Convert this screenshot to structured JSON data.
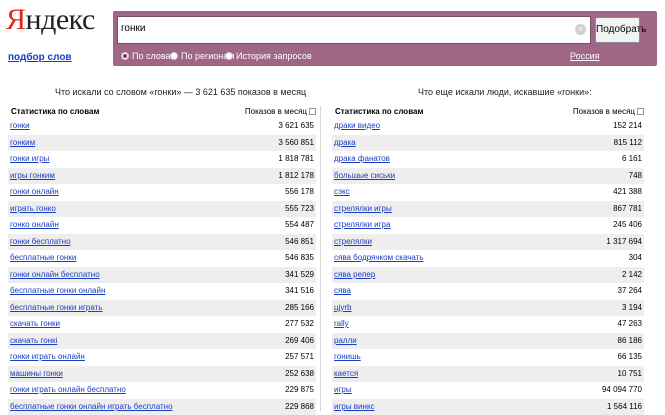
{
  "logo": {
    "first_letter": "Я",
    "rest": "ндекс"
  },
  "sub_link": "подбор слов",
  "search": {
    "value": "гонки",
    "clear_symbol": "×",
    "button_label": "Подобрать"
  },
  "modes": [
    {
      "label": "По словам",
      "selected": true
    },
    {
      "label": "По регионам",
      "selected": false
    },
    {
      "label": "История запросов",
      "selected": false
    }
  ],
  "region": "Россия",
  "left_panel": {
    "title": "Что искали со словом «гонки» — 3 621 635 показов в месяц",
    "col_query": "Статистика по словам",
    "col_count": "Показов в месяц",
    "rows": [
      {
        "q": "гонки",
        "n": "3 621 635"
      },
      {
        "q": "гонким",
        "n": "3 560 851"
      },
      {
        "q": "гонки игры",
        "n": "1 818 781"
      },
      {
        "q": "игры гонким",
        "n": "1 812 178"
      },
      {
        "q": "гонки онлайн",
        "n": "556 178"
      },
      {
        "q": "играть гонко",
        "n": "555 723"
      },
      {
        "q": "гонко онлайн",
        "n": "554 487"
      },
      {
        "q": "гонки бесплатно",
        "n": "546 851"
      },
      {
        "q": "бесплатные гонки",
        "n": "546 835"
      },
      {
        "q": "гонки онлайн бесплатно",
        "n": "341 529"
      },
      {
        "q": "бесплатные гонки онлайн",
        "n": "341 516"
      },
      {
        "q": "бесплатные гонки играть",
        "n": "285 166"
      },
      {
        "q": "скачать гонки",
        "n": "277 532"
      },
      {
        "q": "скачать гонкі",
        "n": "269 406"
      },
      {
        "q": "гонки играть онлайн",
        "n": "257 571"
      },
      {
        "q": "машины гонки",
        "n": "252 638"
      },
      {
        "q": "гонки играть онлайн бесплатно",
        "n": "229 875"
      },
      {
        "q": "бесплатные гонки онлайн играть бесплатно",
        "n": "229 868"
      }
    ]
  },
  "right_panel": {
    "title": "Что еще искали люди, искавшие «гонки»:",
    "col_query": "Статистика по словам",
    "col_count": "Показов в месяц",
    "rows": [
      {
        "q": "драки видео",
        "n": "152 214"
      },
      {
        "q": "драка",
        "n": "815 112"
      },
      {
        "q": "драка фанатов",
        "n": "6 161"
      },
      {
        "q": "большые сиськи",
        "n": "748"
      },
      {
        "q": "сэкс",
        "n": "421 388"
      },
      {
        "q": "стрелялки игры",
        "n": "867 781"
      },
      {
        "q": "стрелялки игра",
        "n": "245 406"
      },
      {
        "q": "стрелялки",
        "n": "1 317 694"
      },
      {
        "q": "сява бодрячком скачать",
        "n": "304"
      },
      {
        "q": "сява репер",
        "n": "2 142"
      },
      {
        "q": "сява",
        "n": "37 264"
      },
      {
        "q": "цјуrb",
        "n": "3 194"
      },
      {
        "q": "rally",
        "n": "47 263"
      },
      {
        "q": "ралли",
        "n": "86 186"
      },
      {
        "q": "гонишь",
        "n": "66 135"
      },
      {
        "q": "кается",
        "n": "10 751"
      },
      {
        "q": "игры",
        "n": "94 094 770"
      },
      {
        "q": "игры винкс",
        "n": "1 564 116"
      }
    ]
  }
}
